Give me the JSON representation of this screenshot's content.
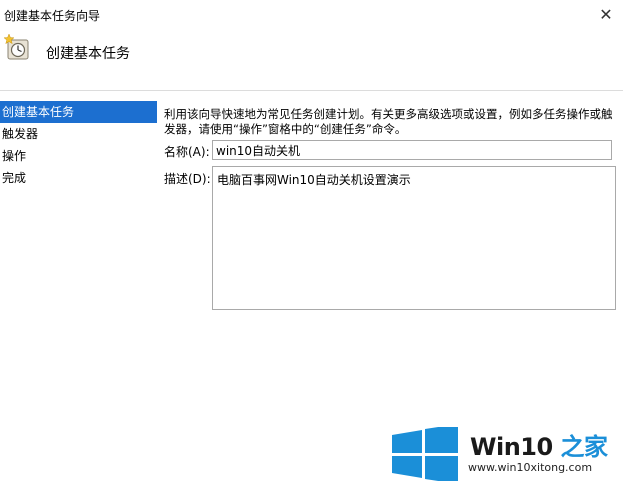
{
  "window": {
    "title": "创建基本任务向导",
    "close_glyph": "✕"
  },
  "header": {
    "title": "创建基本任务",
    "icon": "task-clock-wizard-icon"
  },
  "sidebar": {
    "items": [
      {
        "label": "创建基本任务",
        "active": true
      },
      {
        "label": "触发器",
        "active": false
      },
      {
        "label": "操作",
        "active": false
      },
      {
        "label": "完成",
        "active": false
      }
    ]
  },
  "form": {
    "intro": "利用该向导快速地为常见任务创建计划。有关更多高级选项或设置，例如多任务操作或触发器，请使用“操作”窗格中的“创建任务”命令。",
    "name_label": "名称(A):",
    "name_value": "win10自动关机",
    "desc_label": "描述(D):",
    "desc_value": "电脑百事网Win10自动关机设置演示"
  },
  "watermark": {
    "brand_prefix": "Win10 ",
    "brand_suffix": "之家",
    "url": "www.win10xitong.com"
  },
  "colors": {
    "selection": "#1c6fd0",
    "win_logo": "#1b8fd8"
  }
}
